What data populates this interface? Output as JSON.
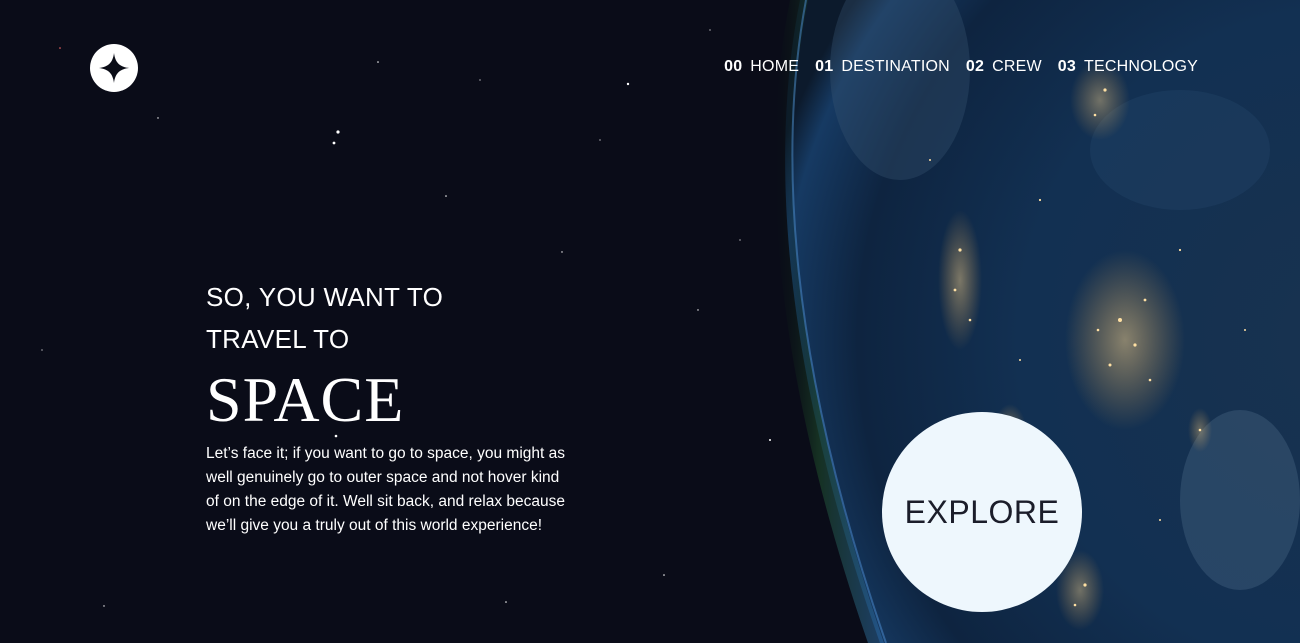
{
  "brand": {
    "logo_icon": "four-point-star-icon"
  },
  "nav": {
    "items": [
      {
        "num": "00",
        "label": "HOME"
      },
      {
        "num": "01",
        "label": "DESTINATION"
      },
      {
        "num": "02",
        "label": "CREW"
      },
      {
        "num": "03",
        "label": "TECHNOLOGY"
      }
    ]
  },
  "hero": {
    "eyebrow_line1": "SO, YOU WANT TO",
    "eyebrow_line2": "TRAVEL TO",
    "headline": "SPACE",
    "description": "Let’s face it; if you want to go to space, you might as well genuinely go to outer space and not hover kind of on the edge of it. Well sit back, and relax because we’ll give you a truly out of this world experience!",
    "cta": "EXPLORE"
  },
  "colors": {
    "background": "#0b0d17",
    "text": "#ffffff",
    "cta_background": "#eef7fd",
    "cta_text": "#1b1d2a"
  }
}
